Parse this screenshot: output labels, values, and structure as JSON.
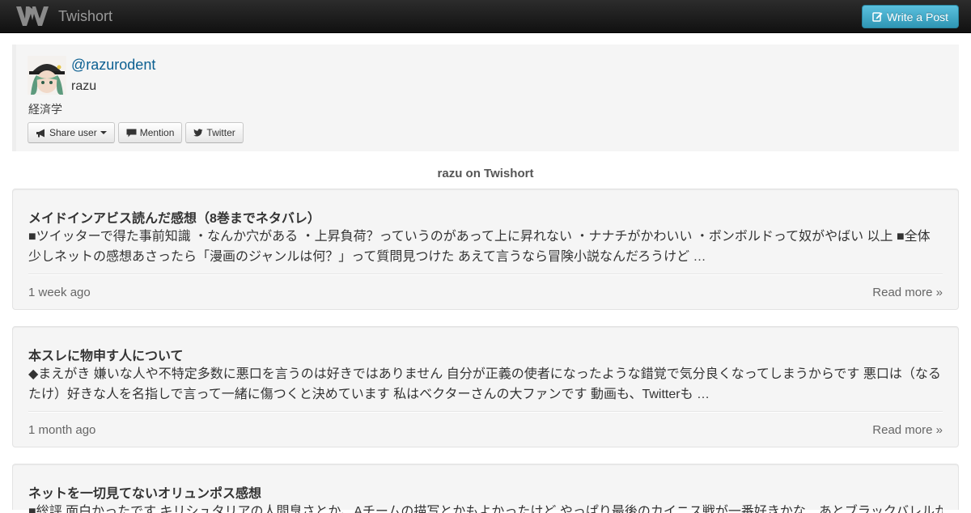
{
  "navbar": {
    "brand_name": "Twishort",
    "write_button_label": "Write a Post"
  },
  "profile": {
    "username": "@razurodent",
    "name": "razu",
    "bio": "経済学",
    "buttons": {
      "share": "Share user",
      "mention": "Mention",
      "twitter": "Twitter"
    }
  },
  "section_title": "razu on Twishort",
  "posts": [
    {
      "title": "メイドインアビス読んだ感想（8巻までネタバレ）",
      "excerpt": "■ツイッターで得た事前知識 ・なんか穴がある ・上昇負荷？っていうのがあって上に昇れない ・ナナチがかわいい ・ボンボルドって奴がやばい 以上 ■全体 少しネットの感想あさったら「漫画のジャンルは何？」って質問見つけた あえて言うなら冒険小説なんだろうけど …",
      "time": "1 week ago",
      "read_more": "Read more »"
    },
    {
      "title": "本スレに物申す人について",
      "excerpt": "◆まえがき 嫌いな人や不特定多数に悪口を言うのは好きではありません 自分が正義の使者になったような錯覚で気分良くなってしまうからです 悪口は（なるたけ）好きな人を名指しで言って一緒に傷つくと決めています 私はベクターさんの大ファンです 動画も、Twitterも …",
      "time": "1 month ago",
      "read_more": "Read more »"
    },
    {
      "title": "ネットを一切見てないオリュンポス感想",
      "excerpt": "■総評 面白かったです キリシュタリアの人間臭さとか、Aチームの描写とかもよかったけど やっぱり最後のカイニス戦が一番好きかな…あとブラックバレルか",
      "time": "",
      "read_more": ""
    }
  ]
}
